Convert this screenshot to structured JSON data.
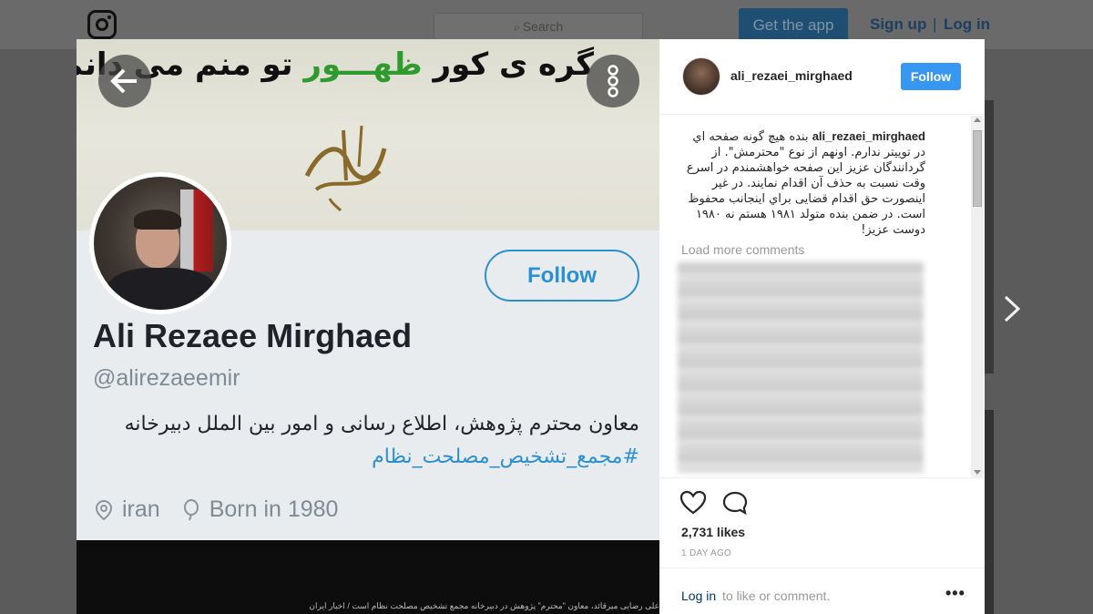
{
  "header": {
    "search_placeholder": "Search",
    "get_app_label": "Get the app",
    "sign_up_label": "Sign up",
    "separator": "|",
    "log_in_label": "Log in"
  },
  "tweet": {
    "banner_text_a": "گره ی کور",
    "banner_text_green": "ظهـــور",
    "banner_text_b": "تو منم می دانم",
    "follow_label": "Follow",
    "name": "Ali Rezaee Mirghaed",
    "handle": "@alirezaeemir",
    "bio": "معاون محترم پژوهش، اطلاع رسانی و امور بین الملل دبیرخانه",
    "hashtag": "#مجمع_تشخیص_مصلحت_نظام",
    "location": "iran",
    "born": "Born in 1980",
    "bottom_caption": "علی رضایی میرقائد، معاون \"محترم\" پژوهش در دبیرخانه مجمع تشخیص مصلحت نظام است / اخبار ایران"
  },
  "post": {
    "username": "ali_rezaei_mirghaed",
    "follow_label": "Follow",
    "caption_user": "ali_rezaei_mirghaed",
    "caption_text": "بنده هیچ گونه صفحه اي در توییتر ندارم. اونهم از نوع \"محترمش\". از گردانندگان عزیز این صفحه خواهشمندم در اسرع وقت نسبت به حذف آن اقدام نمایند. در غیر اینصورت حق اقدام قضایی براي اینجانب محفوظ است. در ضمن بنده متولد ۱۹۸۱ هستم نه ۱۹۸۰ دوست عزیز!",
    "load_more": "Load more comments",
    "likes": "2,731 likes",
    "time": "1 DAY AGO",
    "login_link": "Log in",
    "login_rest": "to like or comment.",
    "more_label": "•••"
  },
  "icons": {
    "logo": "instagram-logo-icon",
    "search": "search-icon",
    "back": "arrow-left-icon",
    "more": "more-vertical-icon",
    "next": "chevron-right-icon",
    "heart": "heart-icon",
    "comment": "comment-icon",
    "location": "location-pin-icon",
    "balloon": "balloon-icon"
  },
  "colors": {
    "ig_blue": "#3897f0",
    "twitter_blue": "#2c90d0",
    "green_text": "#2f9b2f"
  }
}
